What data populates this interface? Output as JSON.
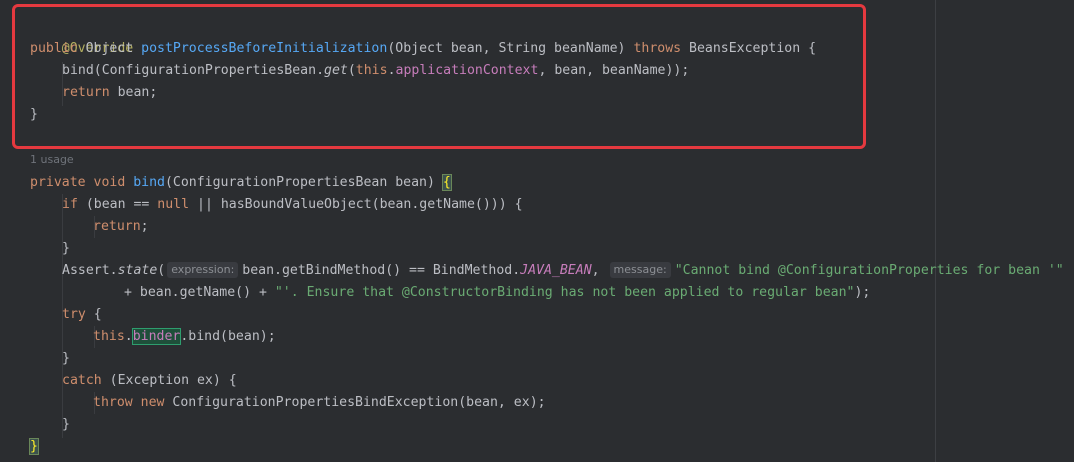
{
  "editor": {
    "usage_hint": "1 usage",
    "hints": {
      "expression": "expression:",
      "message": "message:"
    },
    "tokens": {
      "override": "@Override",
      "public": "public",
      "object": " Object ",
      "method1": "postProcessBeforeInitialization",
      "sig1": "(Object bean, String beanName) ",
      "throws": "throws",
      "sig2": " BeansException {",
      "l3a": "bind(ConfigurationPropertiesBean.",
      "l3get": "get",
      "l3b": "(",
      "l3this": "this",
      "l3dot": ".",
      "l3field": "applicationContext",
      "l3c": ", bean, beanName));",
      "return": "return",
      "l4b": " bean;",
      "close": "}",
      "private": "private",
      "void": " void ",
      "method2": "bind",
      "sig3": "(ConfigurationPropertiesBean bean) ",
      "open_brace": "{",
      "if": "if",
      "l8a": " (bean == ",
      "null": "null",
      "l8b": " || hasBoundValueObject(bean.getName())) {",
      "return_semi": "return",
      "semi": ";",
      "assert_a": "Assert.",
      "state": "state",
      "paren": "(",
      "l11b": "bean.getBindMethod() == BindMethod.",
      "java_bean": "JAVA_BEAN",
      "comma": ", ",
      "str1": "\"Cannot bind @ConfigurationProperties for bean '\"",
      "l12a": "+ bean.getName() + ",
      "str2": "\"'. Ensure that @ConstructorBinding has not been applied to regular bean\"",
      "l12b": ");",
      "try": "try",
      "brace_sp": " {",
      "this2": "this",
      "binder": "binder",
      "l14b": ".bind(bean);",
      "catch": "catch",
      "l16b": " (Exception ex) {",
      "throw": "throw",
      "new": " new",
      "l17b": " ConfigurationPropertiesBindException(bean, ex);",
      "close_final": "}"
    }
  }
}
